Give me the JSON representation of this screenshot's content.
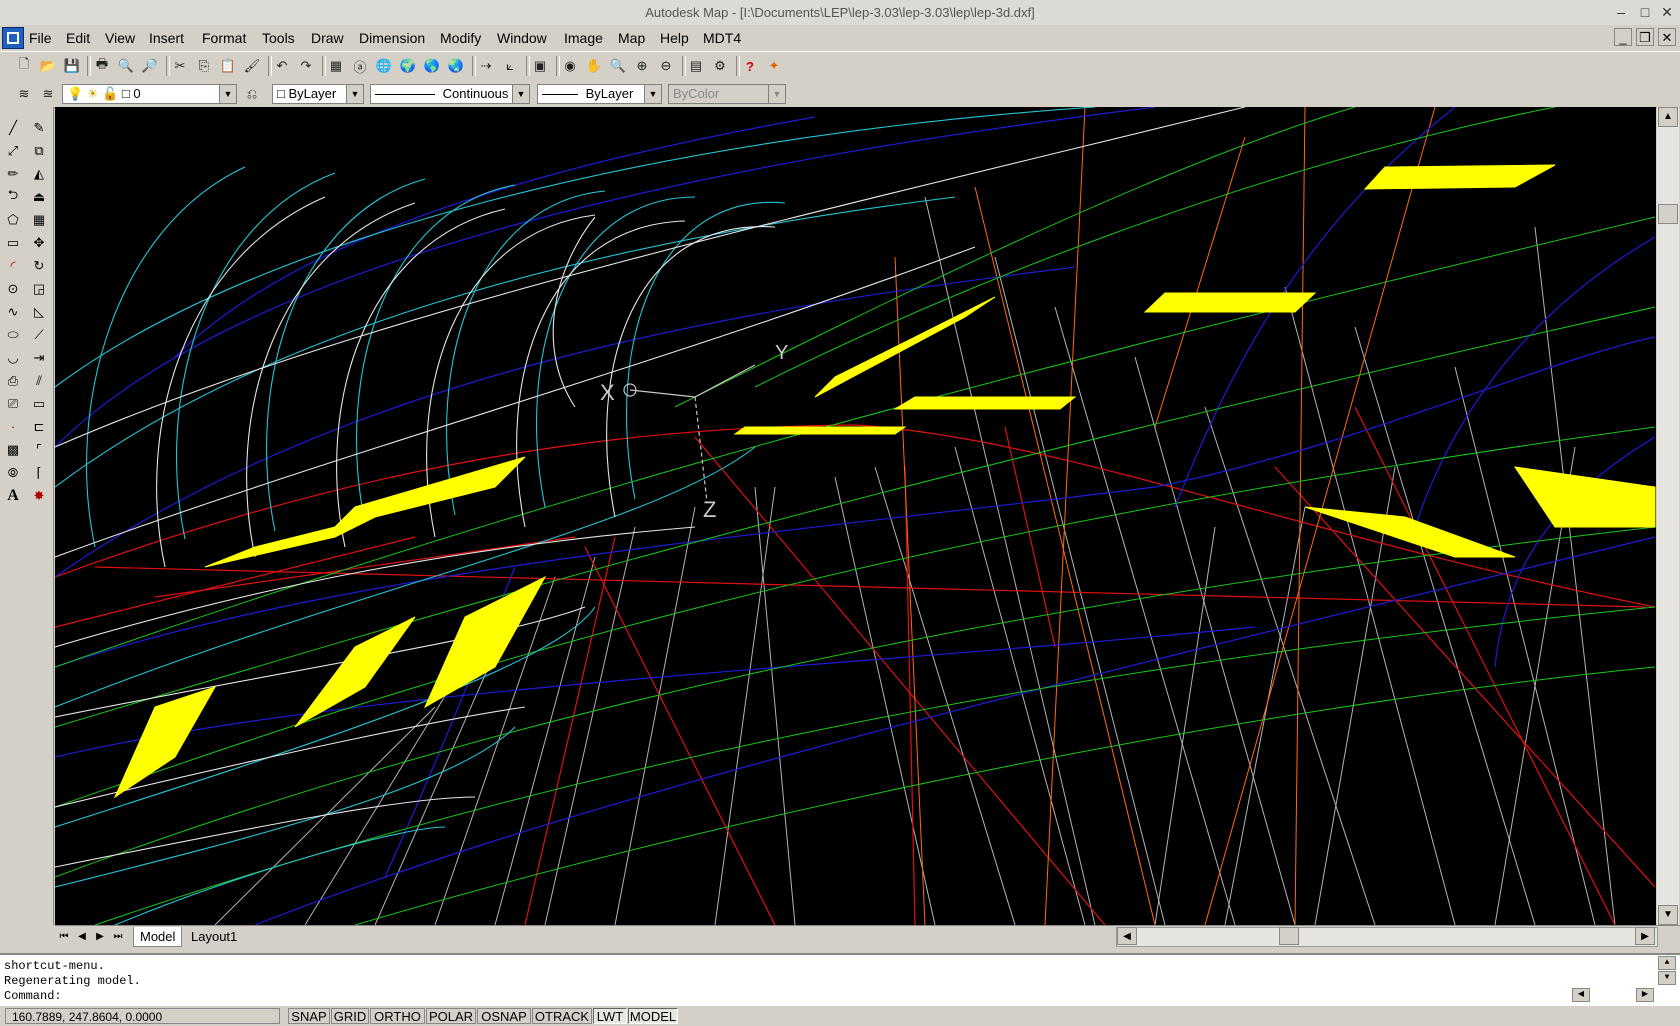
{
  "window": {
    "title": "Autodesk Map - [I:\\Documents\\LEP\\lep-3.03\\lep-3.03\\lep\\lep-3d.dxf]",
    "controls": [
      "–",
      "✕",
      "✕"
    ]
  },
  "menu": {
    "items": [
      "File",
      "Edit",
      "View",
      "Insert",
      "Format",
      "Tools",
      "Draw",
      "Dimension",
      "Modify",
      "Window",
      "Image",
      "Map",
      "Help",
      "MDT4"
    ]
  },
  "properties_bar": {
    "layer": "0",
    "color": "ByLayer",
    "linetype": "Continuous",
    "lineweight": "ByLayer",
    "plotstyle": "ByColor"
  },
  "viewport": {
    "background": "#000000",
    "ucs": {
      "x": "X",
      "y": "Y",
      "z": "Z"
    }
  },
  "tabs": [
    "Model",
    "Layout1"
  ],
  "command": {
    "lines": [
      "shortcut-menu.",
      "Regenerating model."
    ],
    "prompt": "Command:",
    "value": ""
  },
  "status": {
    "coords": "160.7889, 247.8604, 0.0000",
    "toggles": [
      "SNAP",
      "GRID",
      "ORTHO",
      "POLAR",
      "OSNAP",
      "OTRACK",
      "LWT",
      "MODEL"
    ],
    "active": [
      "LWT",
      "MODEL"
    ]
  },
  "colors": {
    "white": "#e6e6e6",
    "cyan": "#23c6d6",
    "blue": "#1c1cd8",
    "green": "#18c618",
    "red": "#e01010",
    "orange": "#ff6a10",
    "gray": "#b4b4b4",
    "yellow": "#ffff00"
  }
}
